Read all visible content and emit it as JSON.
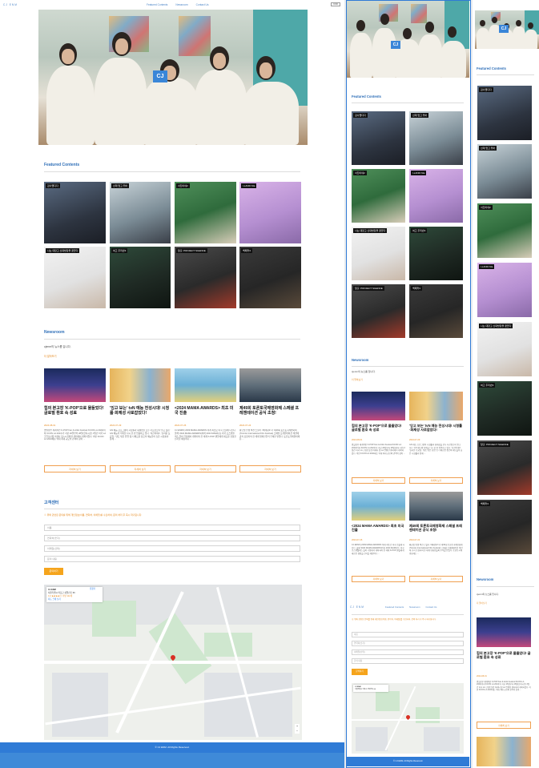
{
  "nav": {
    "logo": "CJ ENM",
    "links": [
      "Featured Contents",
      "Newsroom",
      "Contact Us"
    ],
    "lang": "KOR"
  },
  "hero": {
    "logo_text": "CJ"
  },
  "featured": {
    "title": "Featured Contents",
    "items": [
      {
        "label": "검사랩디다"
      },
      {
        "label": "선재 업고 튀어"
      },
      {
        "label": "서진이네2"
      },
      {
        "label": "I-LAND N/a"
      },
      {
        "label": "나는 대장고 신대방장을 꿈꾼다"
      },
      {
        "label": "여고 추리반3"
      },
      {
        "label": "탈출: PROJECT SILENCE"
      },
      {
        "label": "백패커3"
      }
    ]
  },
  "newsroom": {
    "title": "Newsroom",
    "desc": "cjenm의 뉴스룸 입니다.",
    "more": "더 알아보기",
    "items": [
      {
        "title": "힙의 본고장 'K-POP'으로 물들었다! 글로벌 환호 속 성료",
        "date": "2024-08-01",
        "body": "명실상부 세계적인 K-POP Fan & Artist Festival KCON LA 2024(이하 KCON LA 2024)'가 지난 26일부터 28일(현지시간) 3일간 미국 LA 크립토닷컴 아레나 및 LA 컨벤션 센터에서 개최되었다. 이번 KCON LA 2024에는 역대 최대 규모의 관객이 찾아 ..."
      },
      {
        "title": "'잉고 보는' tvN 예능 전성시대! 시청률·화제성 사로잡았다!",
        "date": "2024-07-29",
        "body": "tvN 예능 프로그램이 시청률과 화제성을 모두 사로잡으며 '믿고 보는' tvN 예능의 저력을 다시 한 번 입증하고 있다. '서진이네2', '놀라운 토요일', '텐트 밖은 유럽' 등 다채로운 장르의 예능들이 높은 시청률과 함께 ..."
      },
      {
        "title": "<2024 MAMA AWARDS> 최초 미국 진출",
        "date": "2024-07-26",
        "body": "CJ ENM이 2009 MAMA AWARDS 이래 최초로 미국 진출에 나선다. 올해 '2024 MAMA AWARDS(이하 2024 MAMA)'는 미국 로스앤젤레스 돌비 극장에서 개최되며 전 세계 K-POP 팬들에게 새로운 경험을 선사할 예정이다 ..."
      },
      {
        "title": "제49회 토론토국제영화제 스페셜 프레젠테이션 공식 초청!",
        "date": "2024-07-24",
        "body": "황금빛 인생 액션 스릴러 <베테랑2>가 제49회 토론토국제영화제(Toronto International Film Festival) 스페셜 프레젠테이션 섹션에 공식 초청되며 전 세계 영화인들의 주목을 받았다. 토론토국제영화제는 ..."
      }
    ],
    "btn": "자세히 보기"
  },
  "contact": {
    "title": "고객센터",
    "notice": "※ 위와 관련된 문의를 위해 개인정보(이름, 연락처, 이메일)를 수집하며, 문의 처리 후 즉시 파기됩니다.",
    "fields": [
      "이름",
      "연락처(숫자)",
      "이메일(선택)",
      "문의 내용"
    ],
    "submit": "문의하기"
  },
  "map": {
    "place": "CJ ENM",
    "address": "서울특별시 마포구 상암산로 66",
    "rating": "4.4 ★★★★☆ 리뷰 112개",
    "larger": "지도 크게 보기",
    "directions": "길찾기"
  },
  "footer": {
    "copyright": "© CJ ENM. All Rights Reserved."
  }
}
